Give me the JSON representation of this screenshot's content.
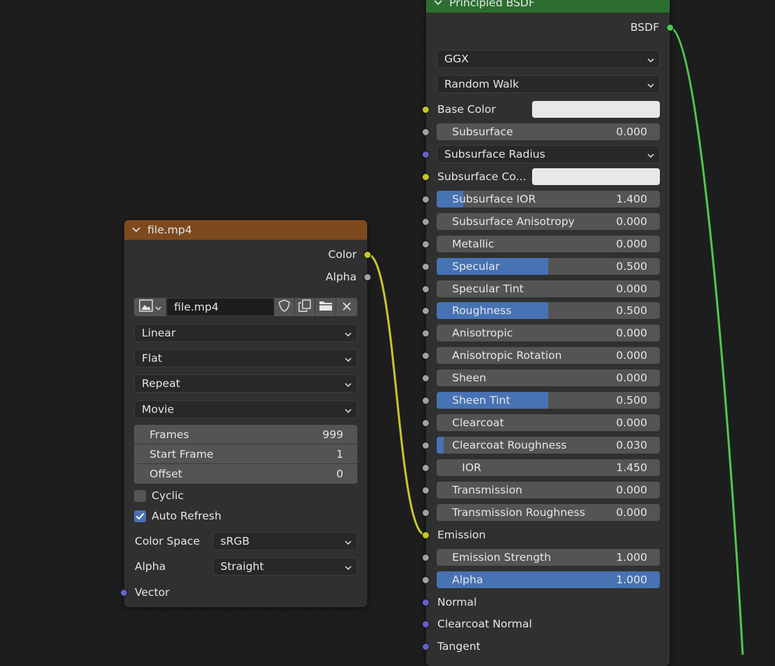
{
  "colors": {
    "socket_color": "#c7c729",
    "socket_float": "#a1a1a1",
    "socket_vector": "#6363c7",
    "socket_shader": "#4fc750",
    "image_header": "#7d4a1e",
    "shader_header": "#2b6e2f",
    "slider_fill": "#4772b3"
  },
  "image_node": {
    "title": "file.mp4",
    "outputs": {
      "color": "Color",
      "alpha": "Alpha"
    },
    "image_name": "file.mp4",
    "interpolation": "Linear",
    "projection": "Flat",
    "extension": "Repeat",
    "source": "Movie",
    "frames_label": "Frames",
    "frames_value": "999",
    "start_frame_label": "Start Frame",
    "start_frame_value": "1",
    "offset_label": "Offset",
    "offset_value": "0",
    "cyclic_label": "Cyclic",
    "cyclic_checked": false,
    "auto_refresh_label": "Auto Refresh",
    "auto_refresh_checked": true,
    "color_space_label": "Color Space",
    "color_space_value": "sRGB",
    "alpha_label": "Alpha",
    "alpha_value": "Straight",
    "vector_label": "Vector"
  },
  "bsdf_node": {
    "title": "Principled BSDF",
    "output_label": "BSDF",
    "distribution": "GGX",
    "subsurface_method": "Random Walk",
    "base_color_label": "Base Color",
    "subsurface_color_label": "Subsurface Co...",
    "subsurface_radius_label": "Subsurface Radius",
    "emission_label": "Emission",
    "normal_label": "Normal",
    "clearcoat_normal_label": "Clearcoat Normal",
    "tangent_label": "Tangent",
    "subsurface": {
      "label": "Subsurface",
      "value": "0.000",
      "fill": 0.0
    },
    "subsurface_ior": {
      "label": "Subsurface IOR",
      "value": "1.400",
      "fill": 0.12
    },
    "subsurface_anisotropy": {
      "label": "Subsurface Anisotropy",
      "value": "0.000",
      "fill": 0.0
    },
    "metallic": {
      "label": "Metallic",
      "value": "0.000",
      "fill": 0.0
    },
    "specular": {
      "label": "Specular",
      "value": "0.500",
      "fill": 0.5
    },
    "specular_tint": {
      "label": "Specular Tint",
      "value": "0.000",
      "fill": 0.0
    },
    "roughness": {
      "label": "Roughness",
      "value": "0.500",
      "fill": 0.5
    },
    "anisotropic": {
      "label": "Anisotropic",
      "value": "0.000",
      "fill": 0.0
    },
    "anisotropic_rotation": {
      "label": "Anisotropic Rotation",
      "value": "0.000",
      "fill": 0.0
    },
    "sheen": {
      "label": "Sheen",
      "value": "0.000",
      "fill": 0.0
    },
    "sheen_tint": {
      "label": "Sheen Tint",
      "value": "0.500",
      "fill": 0.5
    },
    "clearcoat": {
      "label": "Clearcoat",
      "value": "0.000",
      "fill": 0.0
    },
    "clearcoat_roughness": {
      "label": "Clearcoat Roughness",
      "value": "0.030",
      "fill": 0.03
    },
    "ior": {
      "label": "IOR",
      "value": "1.450",
      "fill": 0.0
    },
    "transmission": {
      "label": "Transmission",
      "value": "0.000",
      "fill": 0.0
    },
    "transmission_roughness": {
      "label": "Transmission Roughness",
      "value": "0.000",
      "fill": 0.0
    },
    "emission_strength": {
      "label": "Emission Strength",
      "value": "1.000",
      "fill": 0.0
    },
    "alpha": {
      "label": "Alpha",
      "value": "1.000",
      "fill": 1.0
    }
  }
}
